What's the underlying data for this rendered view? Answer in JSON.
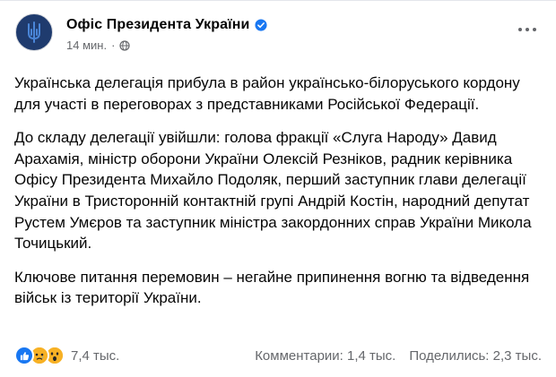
{
  "post": {
    "page_name": "Офіс Президента України",
    "time": "14 мин.",
    "separator": "·",
    "paragraphs": [
      "Українська делегація прибула в район українсько-білоруського кордону для участі в переговорах з представниками Російської Федерації.",
      "До складу делегації увійшли: голова фракції «Слуга Народу» Давид Арахамія, міністр оборони України Олексій Резніков, радник керівника Офісу Президента Михайло Подоляк, перший заступник глави делегації України в Тристоронній контактній групі Андрій Костін, народний депутат Рустем Умєров та заступник міністра закордонних справ України Микола Точицький.",
      "Ключове питання перемовин – негайне припинення вогню та відведення військ із території України."
    ]
  },
  "footer": {
    "reactions_count": "7,4 тыс.",
    "comments": "Комментарии: 1,4 тыс.",
    "shares": "Поделились: 2,3 тыс."
  },
  "icons": {
    "avatar": "trident-logo-icon",
    "verified": "verified-badge-icon",
    "audience": "globe-icon",
    "more": "more-options-icon",
    "reactions": [
      "like-icon",
      "sad-icon",
      "wow-icon"
    ]
  },
  "colors": {
    "accent": "#1877f2",
    "secondary_text": "#65676b",
    "avatar_bg": "#1f3b6e"
  }
}
